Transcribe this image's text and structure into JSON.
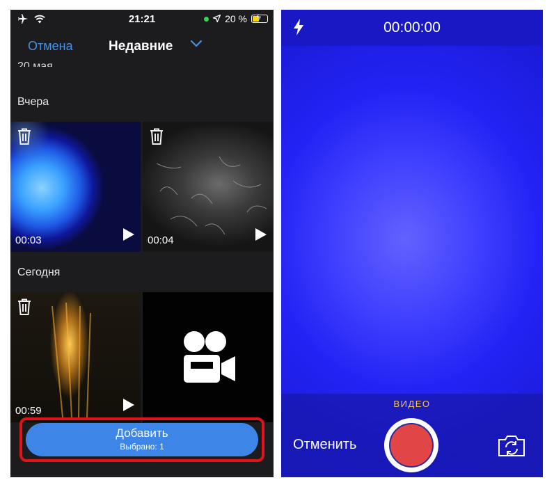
{
  "left_screen": {
    "status_bar": {
      "time": "21:21",
      "battery": "20 %"
    },
    "header": {
      "cancel_label": "Отмена",
      "title": "Недавние"
    },
    "date_partial": "20 мая",
    "sections": [
      {
        "label": "Вчера",
        "videos": [
          {
            "duration": "00:03"
          },
          {
            "duration": "00:04"
          }
        ]
      },
      {
        "label": "Сегодня",
        "videos": [
          {
            "duration": "00:59"
          }
        ]
      }
    ],
    "add_button": {
      "label": "Добавить",
      "selected_text": "Выбрано: 1"
    },
    "colors": {
      "accent": "#3d86e8",
      "highlight": "#e0121a",
      "background": "#1c1c1e"
    }
  },
  "right_screen": {
    "timer": "00:00:00",
    "mode_label": "ВИДЕО",
    "cancel_label": "Отменить",
    "colors": {
      "viewfinder": "#3a3aff",
      "record": "#e24545",
      "mode": "#f5c84a"
    }
  }
}
